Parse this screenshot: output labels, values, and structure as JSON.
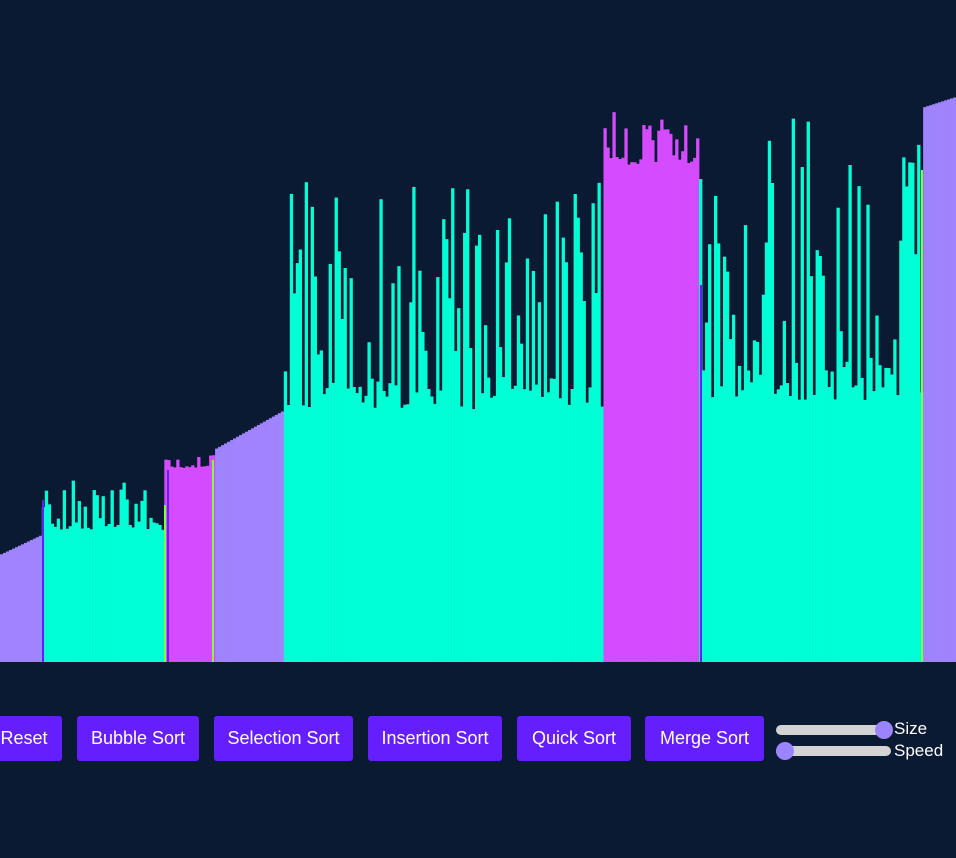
{
  "visualizer": {
    "bar_count": 320,
    "colors": {
      "background": "#0b1a33",
      "sorted": "#a084ff",
      "active": "#00ffd5",
      "pivot": "#d54bff",
      "compare": "#651fff",
      "marker": "#7fff3f"
    },
    "value_range": [
      0,
      100
    ]
  },
  "controls": {
    "buttons": [
      {
        "id": "reset",
        "label": "Reset"
      },
      {
        "id": "bubble",
        "label": "Bubble Sort"
      },
      {
        "id": "selection",
        "label": "Selection Sort"
      },
      {
        "id": "insertion",
        "label": "Insertion Sort"
      },
      {
        "id": "quick",
        "label": "Quick Sort"
      },
      {
        "id": "merge",
        "label": "Merge Sort"
      }
    ],
    "size": {
      "label": "Size",
      "value": 1.0
    },
    "speed": {
      "label": "Speed",
      "value": 0.0
    }
  }
}
